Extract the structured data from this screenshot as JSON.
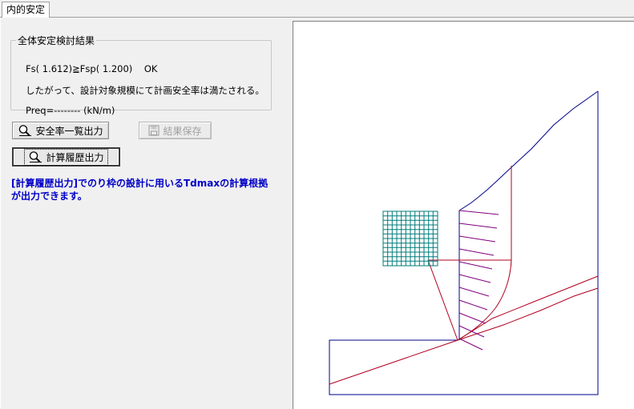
{
  "tabs": [
    {
      "label": "内的安定",
      "active": true
    }
  ],
  "group": {
    "title": "全体安定検討結果",
    "line1": "Fs( 1.612)≧Fsp( 1.200)    OK",
    "line2": "したがって、設計対象規模にて計画安全率は満たされる。",
    "line3": "Preq=-------- (kN/m)"
  },
  "buttons": {
    "safety_list": {
      "label": "安全率一覧出力",
      "icon": "magnifier-icon",
      "enabled": true
    },
    "save_result": {
      "label": "結果保存",
      "icon": "floppy-disk-icon",
      "enabled": false
    },
    "calc_history": {
      "label": "計算履歴出力",
      "icon": "magnifier-icon",
      "enabled": true,
      "focused": true
    }
  },
  "note": {
    "line1": "[計算履歴出力]でのり枠の設計に用いるTdmaxの計算根拠",
    "line2": "が出力できます。"
  },
  "colors": {
    "slope": "#00008b",
    "slip": "#b00020",
    "anchors": "#800080",
    "frame": "#007b7b"
  }
}
